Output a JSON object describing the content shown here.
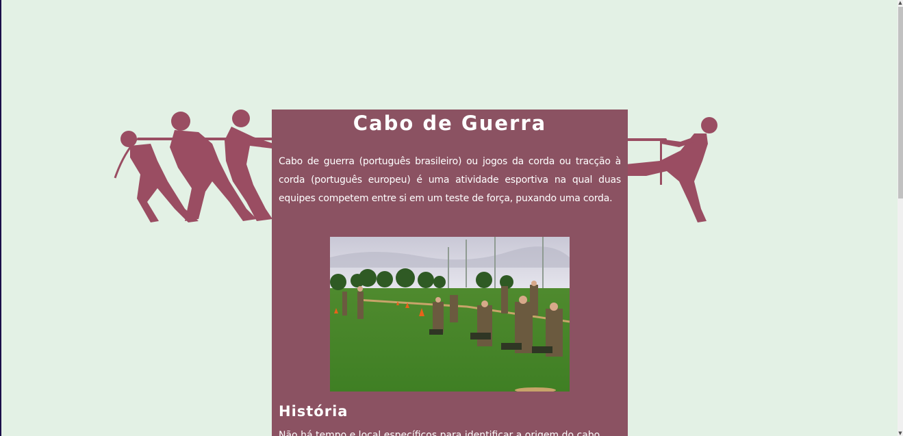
{
  "page": {
    "title": "Cabo de Guerra",
    "intro": "Cabo de guerra (português brasileiro) ou jogos da corda ou tracção à corda (português europeu) é uma atividade esportiva na qual duas equipes competem entre si em um teste de força, puxando uma corda.",
    "history_heading": "História",
    "history_text": "Não há tempo e local específicos para identificar a origem do cabo"
  },
  "colors": {
    "background": "#e3f1e5",
    "card": "#8b5262",
    "silhouette": "#9a4d62",
    "text": "#ffffff"
  },
  "scrollbar": {
    "up_glyph": "▲",
    "down_glyph": "▼"
  },
  "icons": {
    "left_figure": "tug-of-war-team-silhouette",
    "right_figure": "tug-of-war-puller-silhouette",
    "photo": "soldiers-tug-of-war-photo"
  }
}
